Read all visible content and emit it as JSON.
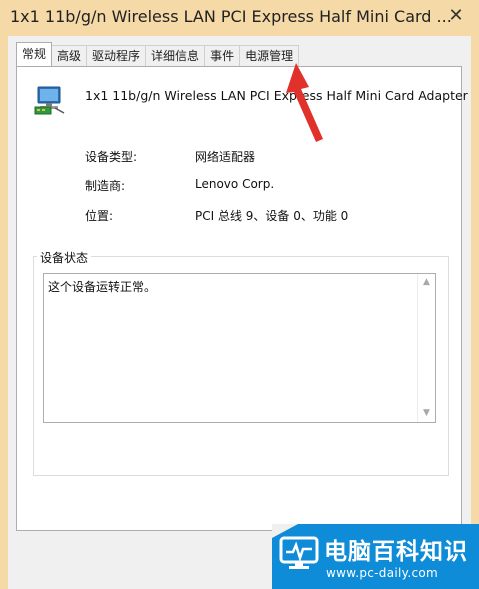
{
  "window": {
    "title": "1x1 11b/g/n Wireless LAN PCI Express Half Mini Card ...",
    "close_glyph": "✕"
  },
  "tabs": [
    {
      "label": "常规",
      "active": true
    },
    {
      "label": "高级",
      "active": false
    },
    {
      "label": "驱动程序",
      "active": false
    },
    {
      "label": "详细信息",
      "active": false
    },
    {
      "label": "事件",
      "active": false
    },
    {
      "label": "电源管理",
      "active": false
    }
  ],
  "general": {
    "device_icon": "network-adapter-icon",
    "device_name": "1x1 11b/g/n Wireless LAN PCI Express Half Mini Card Adapter",
    "properties": [
      {
        "label": "设备类型:",
        "value": "网络适配器"
      },
      {
        "label": "制造商:",
        "value": "Lenovo Corp."
      },
      {
        "label": "位置:",
        "value": "PCI 总线 9、设备 0、功能 0"
      }
    ],
    "status_group_title": "设备状态",
    "status_text": "这个设备运转正常。"
  },
  "annotation": {
    "color": "#e0312a",
    "icon": "red-arrow-pointing-to-power-tab"
  },
  "watermark": {
    "text_cn": "电脑百科知识",
    "url": "www.pc-daily.com",
    "bg_color": "#0e8cd8"
  }
}
